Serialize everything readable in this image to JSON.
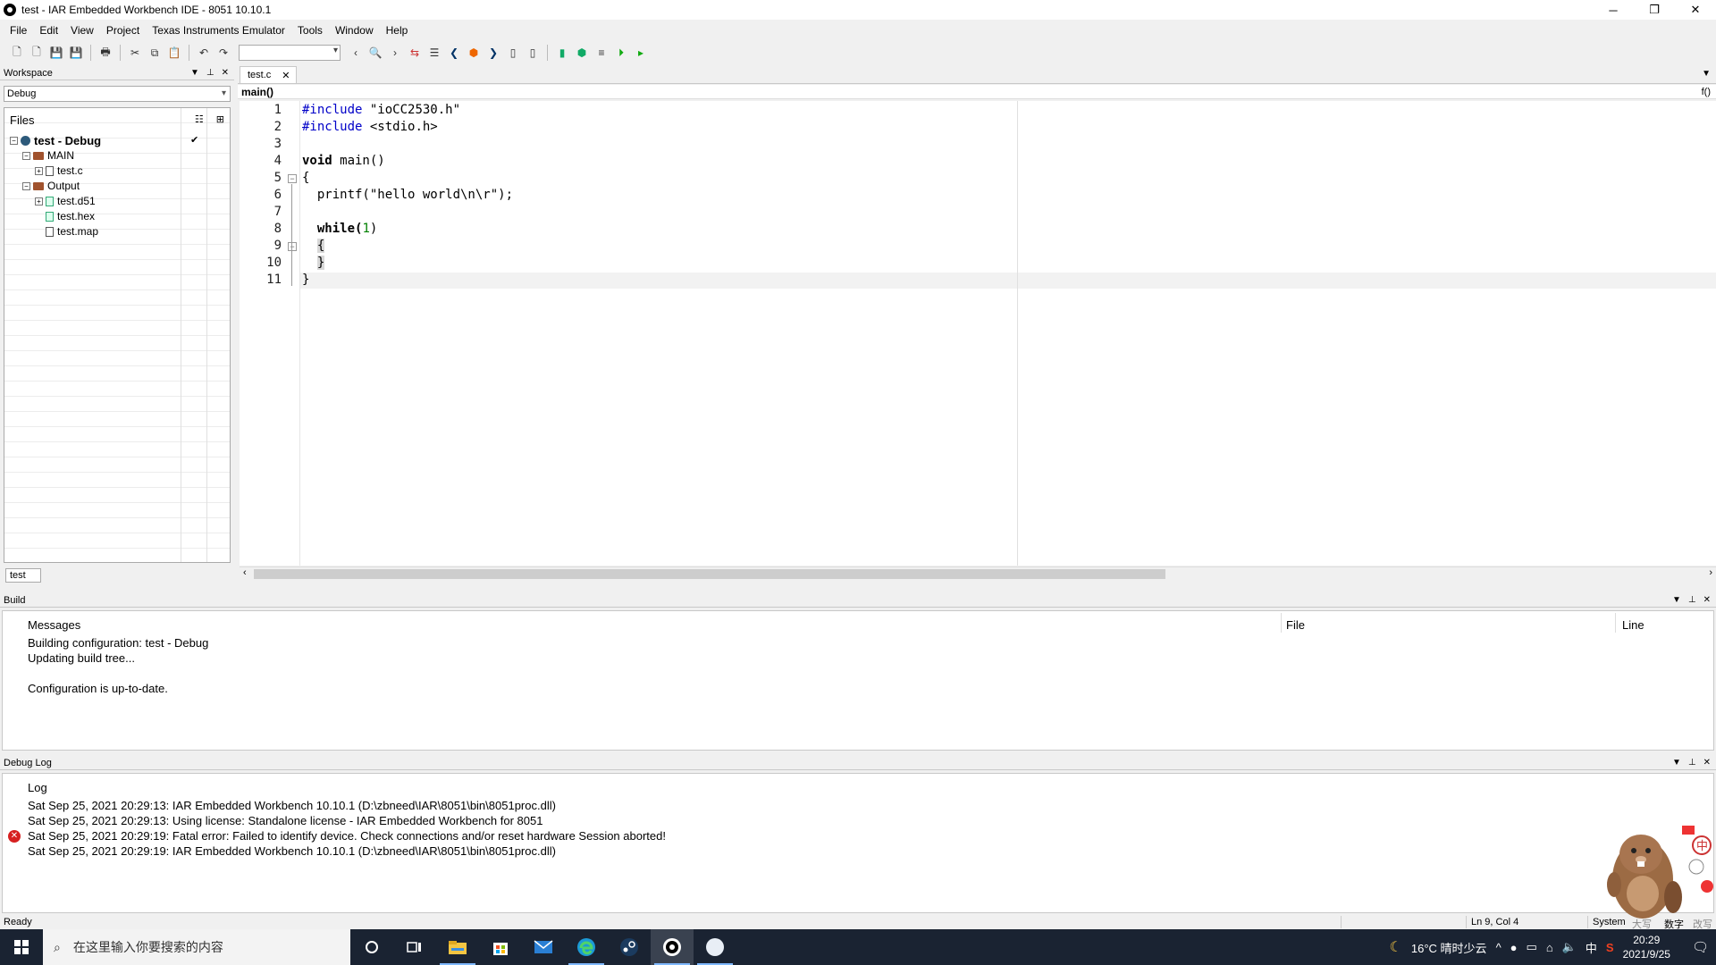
{
  "window": {
    "title": "test - IAR Embedded Workbench IDE - 8051 10.10.1",
    "minimize": "─",
    "restore": "❐",
    "close": "✕"
  },
  "menu": [
    "File",
    "Edit",
    "View",
    "Project",
    "Texas Instruments Emulator",
    "Tools",
    "Window",
    "Help"
  ],
  "workspace": {
    "title": "Workspace",
    "config": "Debug",
    "files_header": "Files",
    "tree": [
      {
        "label": "test - Debug",
        "level": 0,
        "type": "project",
        "bold": true,
        "checked": true
      },
      {
        "label": "MAIN",
        "level": 1,
        "type": "folder"
      },
      {
        "label": "test.c",
        "level": 2,
        "type": "file"
      },
      {
        "label": "Output",
        "level": 1,
        "type": "folder"
      },
      {
        "label": "test.d51",
        "level": 2,
        "type": "filegreen"
      },
      {
        "label": "test.hex",
        "level": 2,
        "type": "filegreen"
      },
      {
        "label": "test.map",
        "level": 2,
        "type": "file"
      }
    ],
    "tab": "test"
  },
  "editor": {
    "tab": "test.c",
    "function": "main()",
    "lines": [
      "#include \"ioCC2530.h\"",
      "#include <stdio.h>",
      "",
      "void main()",
      "{",
      "  printf(\"hello world\\n\\r\");",
      "",
      "  while(1)",
      "  {",
      "  }",
      "}"
    ]
  },
  "build": {
    "title": "Build",
    "columns": [
      "Messages",
      "File",
      "Line"
    ],
    "messages": [
      "Building configuration: test - Debug",
      "Updating build tree...",
      "",
      "Configuration is up-to-date."
    ]
  },
  "debug_log": {
    "title": "Debug Log",
    "column": "Log",
    "entries": [
      {
        "text": "Sat Sep 25, 2021 20:29:13: IAR Embedded Workbench 10.10.1 (D:\\zbneed\\IAR\\8051\\bin\\8051proc.dll)",
        "error": false
      },
      {
        "text": "Sat Sep 25, 2021 20:29:13: Using license: Standalone license - IAR Embedded Workbench for 8051",
        "error": false
      },
      {
        "text": "Sat Sep 25, 2021 20:29:19: Fatal error: Failed to identify device. Check connections and/or reset hardware   Session aborted!",
        "error": true
      },
      {
        "text": "Sat Sep 25, 2021 20:29:19: IAR Embedded Workbench 10.10.1 (D:\\zbneed\\IAR\\8051\\bin\\8051proc.dll)",
        "error": false
      }
    ]
  },
  "status": {
    "ready": "Ready",
    "position": "Ln 9, Col 4",
    "encoding": "System",
    "caps": "大写",
    "num": "数字",
    "ovr": "改写"
  },
  "taskbar": {
    "search_placeholder": "在这里输入你要搜索的内容",
    "weather": "16°C  晴时少云",
    "ime": "中",
    "time": "20:29",
    "date": "2021/9/25"
  },
  "colors": {
    "preprocessor": "#0000c8",
    "number": "#008000",
    "error": "#d62020",
    "taskbar": "#1a2332"
  }
}
